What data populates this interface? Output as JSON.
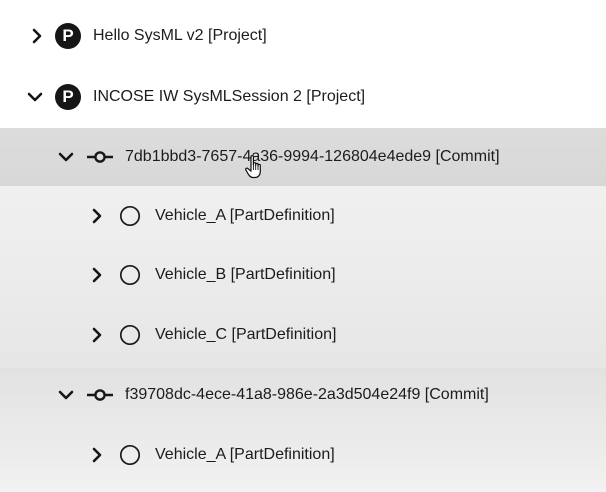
{
  "tree": {
    "items": [
      {
        "type": "project",
        "badge": "P",
        "label": "Hello SysML v2 [Project]",
        "expanded": false
      },
      {
        "type": "project",
        "badge": "P",
        "label": "INCOSE IW SysMLSession 2 [Project]",
        "expanded": true
      },
      {
        "type": "commit",
        "label": "7db1bbd3-7657-4a36-9994-126804e4ede9 [Commit]",
        "expanded": true,
        "hovered": true
      },
      {
        "type": "part-definition",
        "label": "Vehicle_A [PartDefinition]",
        "expanded": false
      },
      {
        "type": "part-definition",
        "label": "Vehicle_B [PartDefinition]",
        "expanded": false
      },
      {
        "type": "part-definition",
        "label": "Vehicle_C [PartDefinition]",
        "expanded": false
      },
      {
        "type": "commit",
        "label": "f39708dc-4ece-41a8-986e-2a3d504e24f9 [Commit]",
        "expanded": true
      },
      {
        "type": "part-definition",
        "label": "Vehicle_A [PartDefinition]",
        "expanded": false
      }
    ]
  },
  "icons": {
    "collapsed": "chevron-right-icon",
    "expanded": "chevron-down-icon",
    "project": "project-badge-icon",
    "commit": "commit-icon",
    "part_definition": "circle-icon",
    "cursor": "hand-pointer-cursor"
  },
  "colors": {
    "hover_band": "#d8d8d8",
    "selection_band": "#ececec",
    "icon": "#161616"
  }
}
